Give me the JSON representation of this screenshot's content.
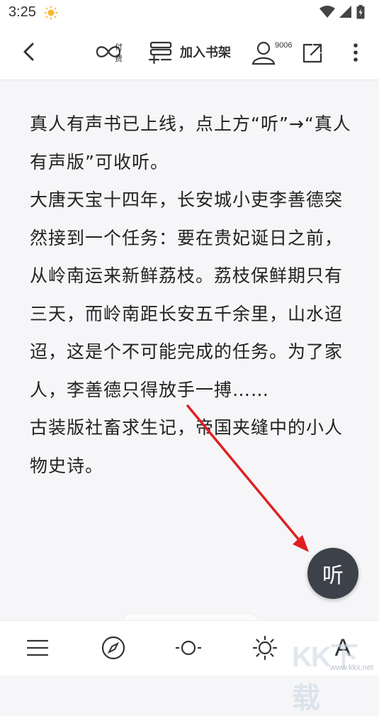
{
  "status_bar": {
    "time": "3:25"
  },
  "header": {
    "paid_label": "付费",
    "shelf_label": "加入书架",
    "user_count": "9006"
  },
  "content": {
    "paragraphs": [
      "真人有声书已上线，点上方“听”→“真人有声版”可收听。",
      "大唐天宝十四年，长安城小吏李善德突然接到一个任务：要在贵妃诞日之前，从岭南运来新鲜荔枝。荔枝保鲜期只有三天，而岭南距长安五千余里，山水迢迢，这是个不可能完成的任务。为了家人，李善德只得放手一搏……",
      "古装版社畜求生记，帝国夹缝中的小人物史诗。"
    ]
  },
  "listen_button": {
    "label": "听"
  },
  "bottom_bar": {
    "font_label": "A"
  },
  "watermark": {
    "logo": "KK下载",
    "url": "www.kkx.net"
  }
}
